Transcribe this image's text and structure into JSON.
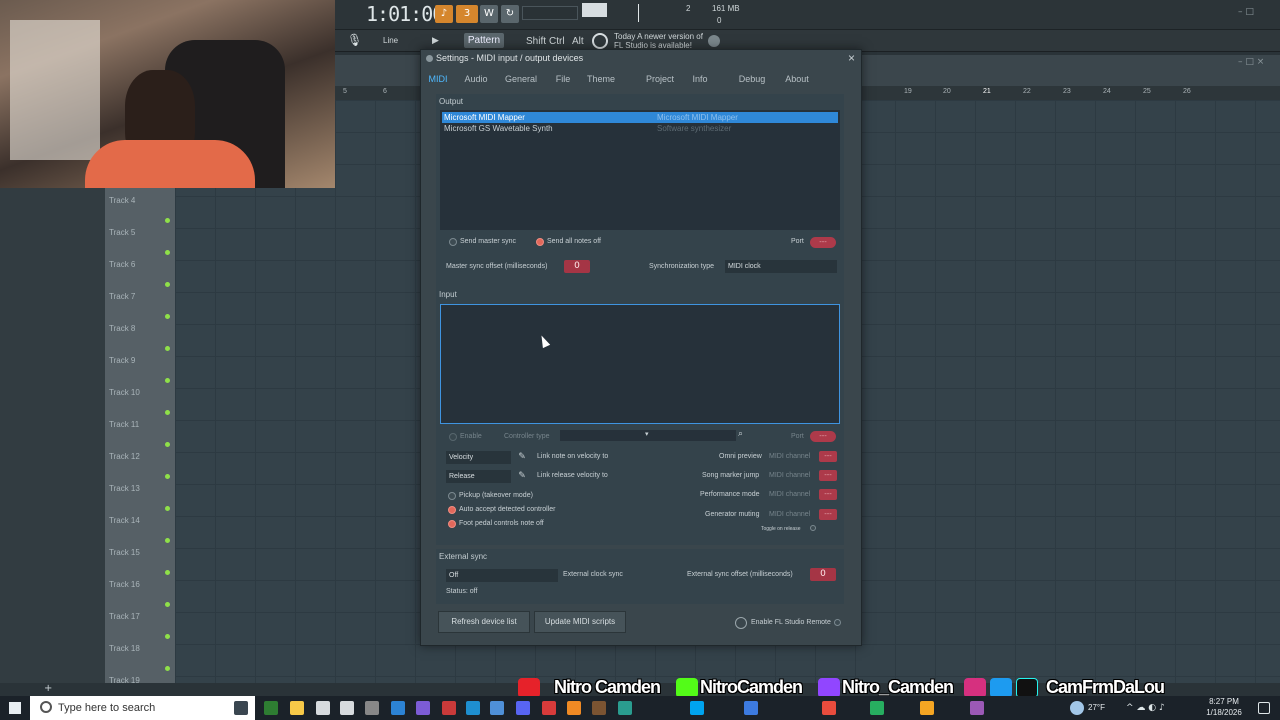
{
  "transport": {
    "time": "1:01:00",
    "stat_a": "2",
    "stat_b": "0",
    "memory": "161 MB",
    "mode_label": "Line",
    "pattern_label": "Pattern 1",
    "keys": [
      "Shift",
      "Ctrl",
      "Alt"
    ],
    "news_line1": "Today  A newer version of",
    "news_line2": "FL Studio is available!"
  },
  "ruler": [
    "5",
    "6",
    "19",
    "20",
    "21",
    "22",
    "23",
    "24",
    "25",
    "26"
  ],
  "tracks": [
    "Track 4",
    "Track 5",
    "Track 6",
    "Track 7",
    "Track 8",
    "Track 9",
    "Track 10",
    "Track 11",
    "Track 12",
    "Track 13",
    "Track 14",
    "Track 15",
    "Track 16",
    "Track 17",
    "Track 18",
    "Track 19"
  ],
  "dialog": {
    "title": "Settings - MIDI input / output devices",
    "close": "×",
    "tabs": [
      "MIDI",
      "Audio",
      "General",
      "File",
      "Theme",
      "Project",
      "Info",
      "Debug",
      "About"
    ],
    "output": {
      "title": "Output",
      "devices": [
        {
          "name": "Microsoft MIDI Mapper",
          "desc": "Microsoft MIDI Mapper",
          "selected": true
        },
        {
          "name": "Microsoft GS Wavetable Synth",
          "desc": "Software synthesizer",
          "selected": false
        }
      ],
      "send_master_sync": "Send master sync",
      "send_all_notes_off": "Send all notes off",
      "port_label": "Port",
      "port_value": "---",
      "master_sync_label": "Master sync offset (milliseconds)",
      "master_sync_value": "0",
      "sync_type_label": "Synchronization type",
      "sync_type_value": "MIDI clock"
    },
    "input": {
      "title": "Input",
      "enable": "Enable",
      "controller_type": "Controller type",
      "port_label": "Port",
      "port_value": "---",
      "velocity": "Velocity",
      "release": "Release",
      "link_note_on": "Link note on velocity to",
      "link_release": "Link release velocity to",
      "pickup": "Pickup (takeover mode)",
      "auto_accept": "Auto accept detected controller",
      "foot_pedal": "Foot pedal controls note off",
      "omni_preview": "Omni preview",
      "song_marker_jump": "Song marker jump",
      "performance_mode": "Performance mode",
      "generator_muting": "Generator muting",
      "midi_channel": "MIDI channel",
      "toggle_on_release": "Toggle on release",
      "channel_value": "---"
    },
    "external_sync": {
      "title": "External sync",
      "mode": "Off",
      "ext_clock_sync": "External clock sync",
      "offset_label": "External sync offset (milliseconds)",
      "offset_value": "0",
      "status": "Status: off"
    },
    "buttons": {
      "refresh": "Refresh device list",
      "update": "Update MIDI scripts",
      "enable_remote": "Enable FL Studio Remote"
    }
  },
  "socials": {
    "youtube": "Nitro Camden",
    "kick": "NitroCamden",
    "twitch": "Nitro_Camden",
    "instagram": "CamFrmDaLou"
  },
  "taskbar": {
    "search_placeholder": "Type here to search",
    "weather": "27°F",
    "time": "8:27 PM",
    "date": "1/18/2026"
  },
  "colors": {
    "accent_blue": "#4fb9ff",
    "selection": "#2f88d8",
    "red_control": "#ad3a4a",
    "track_dot": "#8fe049"
  }
}
